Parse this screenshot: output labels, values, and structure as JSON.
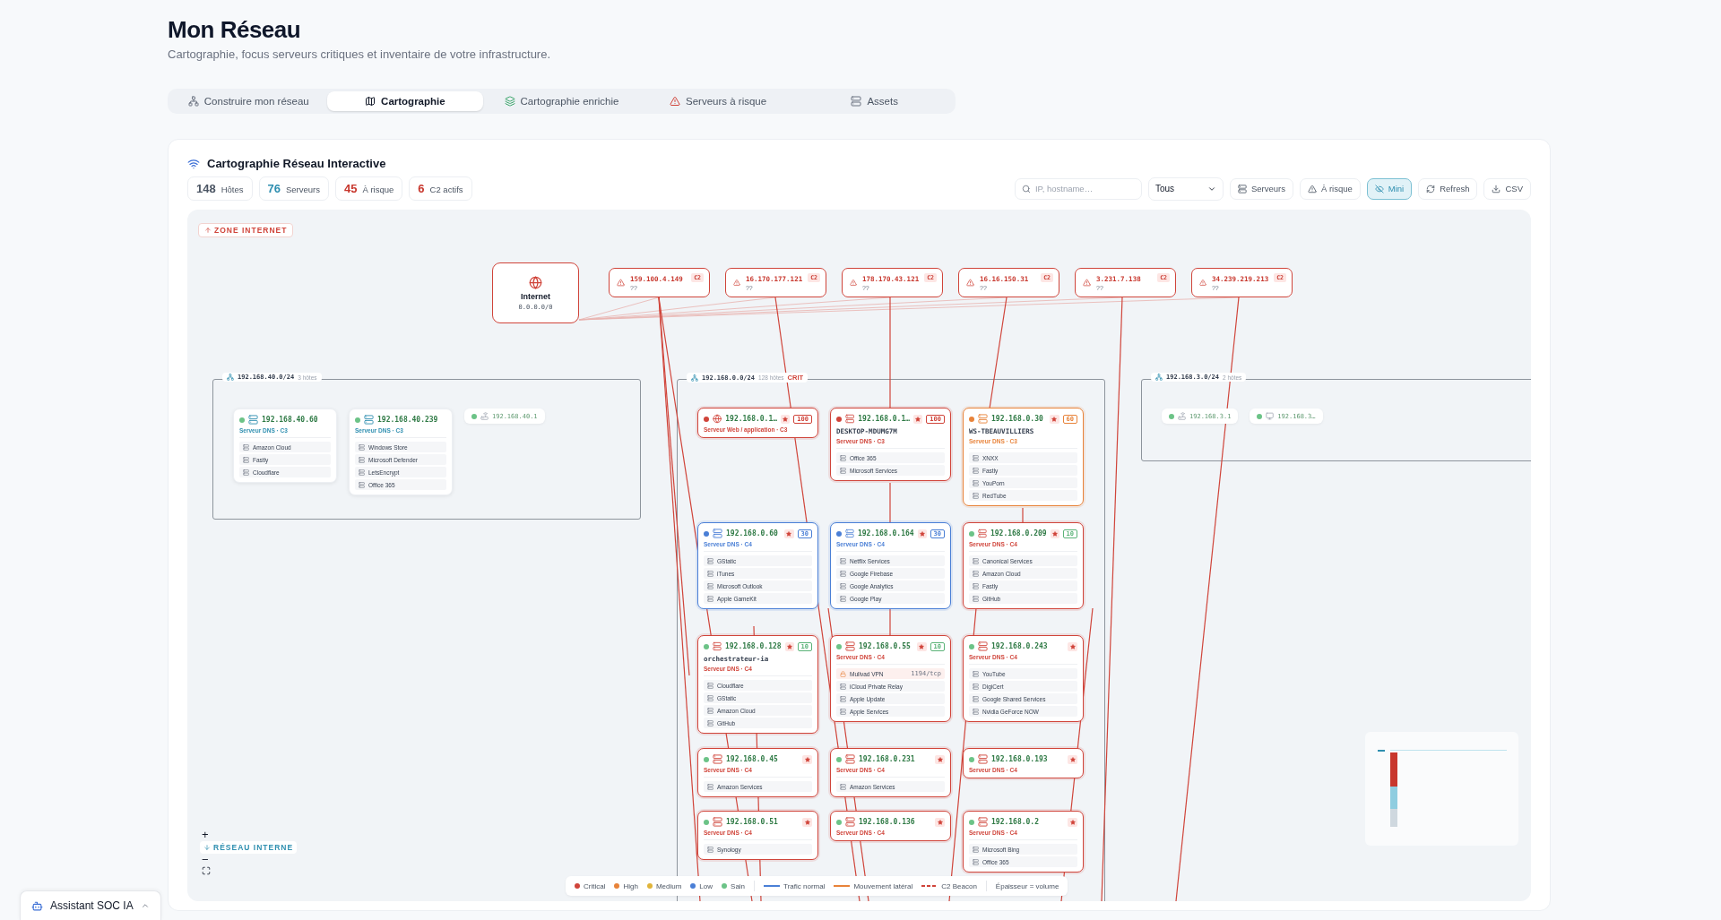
{
  "header": {
    "title": "Mon Réseau",
    "subtitle": "Cartographie, focus serveurs critiques et inventaire de votre infrastructure."
  },
  "tabs": [
    {
      "label": "Construire mon réseau",
      "selected": false
    },
    {
      "label": "Cartographie",
      "selected": true
    },
    {
      "label": "Cartographie enrichie",
      "selected": false
    },
    {
      "label": "Serveurs à risque",
      "selected": false
    },
    {
      "label": "Assets",
      "selected": false
    }
  ],
  "map": {
    "title": "Cartographie Réseau Interactive",
    "stats": [
      {
        "value": "148",
        "label": "Hôtes",
        "color": "#4b5563"
      },
      {
        "value": "76",
        "label": "Serveurs",
        "color": "#2f8fb0"
      },
      {
        "value": "45",
        "label": "À risque",
        "color": "#c8372d"
      },
      {
        "value": "6",
        "label": "C2 actifs",
        "color": "#c8372d"
      }
    ],
    "search": {
      "placeholder": "IP, hostname…"
    },
    "filter": "Tous",
    "buttons": [
      {
        "label": "Serveurs",
        "selected": false
      },
      {
        "label": "À risque",
        "selected": false
      },
      {
        "label": "Mini",
        "selected": true
      },
      {
        "label": "Refresh",
        "selected": false
      },
      {
        "label": "CSV",
        "selected": false
      }
    ],
    "zone_internet": "ZONE INTERNET",
    "zone_interne": "RÉSEAU INTERNE",
    "internet": {
      "label": "Internet",
      "address": "0.0.0.0/0"
    },
    "c2_nodes": [
      {
        "ip": "159.100.4.149",
        "host": "??",
        "tag": "C2"
      },
      {
        "ip": "16.170.177.121",
        "host": "??",
        "tag": "C2"
      },
      {
        "ip": "178.170.43.121",
        "host": "??",
        "tag": "C2"
      },
      {
        "ip": "16.16.150.31",
        "host": "??",
        "tag": "C2"
      },
      {
        "ip": "3.231.7.138",
        "host": "??",
        "tag": "C2"
      },
      {
        "ip": "34.239.219.213",
        "host": "??",
        "tag": "C2"
      }
    ],
    "subnets": [
      {
        "cidr": "192.168.40.0/24",
        "count": "3 hôtes",
        "hosts": [
          {
            "ip": "192.168.40.60",
            "kind": "server",
            "color": "#6cc387",
            "role": "Serveur DNS · C3",
            "flagged": false,
            "services": [
              {
                "name": "Amazon Cloud",
                "kind": "service"
              },
              {
                "name": "Fastly",
                "kind": "service"
              },
              {
                "name": "Cloudflare",
                "kind": "service"
              }
            ]
          },
          {
            "ip": "192.168.40.239",
            "kind": "server",
            "color": "#6cc387",
            "role": "Serveur DNS · C3",
            "flagged": false,
            "services": [
              {
                "name": "Windows Store",
                "kind": "service"
              },
              {
                "name": "Microsoft Defender",
                "kind": "service"
              },
              {
                "name": "LetsEncrypt",
                "kind": "service"
              },
              {
                "name": "Office 365",
                "kind": "service"
              }
            ]
          },
          {
            "ip": "192.168.40.1",
            "kind": "router",
            "color": "#6cc387"
          }
        ]
      },
      {
        "cidr": "192.168.0.0/24",
        "count": "128 hôtes",
        "tag": "CRIT",
        "hosts": [
          {
            "ip": "192.168.0.1…",
            "kind": "web",
            "color": "#d0443a",
            "role": "Serveur Web / application · C3",
            "border": {
              "color": "#d0443a"
            },
            "flagged": true,
            "score": {
              "value": "100",
              "color": "#d0443a"
            }
          },
          {
            "ip": "192.168.0.1…",
            "kind": "server",
            "color": "#d0443a",
            "hostname": "DESKTOP-MDUMG7M",
            "role": "Serveur DNS · C3",
            "border": {
              "color": "#d0443a"
            },
            "flagged": true,
            "score": {
              "value": "100",
              "color": "#d0443a"
            },
            "services": [
              {
                "name": "Office 365",
                "kind": "service"
              },
              {
                "name": "Microsoft Services",
                "kind": "service"
              }
            ]
          },
          {
            "ip": "192.168.0.30",
            "kind": "server",
            "color": "#e8833a",
            "hostname": "WS-TBEAUVILLIERS",
            "role": "Serveur DNS · C3",
            "border": {
              "color": "#e8833a"
            },
            "flagged": true,
            "score": {
              "value": "60",
              "color": "#e8833a"
            },
            "services": [
              {
                "name": "XNXX",
                "kind": "service"
              },
              {
                "name": "Fastly",
                "kind": "service"
              },
              {
                "name": "YouPorn",
                "kind": "service"
              },
              {
                "name": "RedTube",
                "kind": "service"
              }
            ]
          },
          {
            "ip": "192.168.0.60",
            "kind": "server",
            "color": "#4a7fd6",
            "role": "Serveur DNS · C4",
            "border": {
              "color": "#4a7fd6"
            },
            "flagged": true,
            "score": {
              "value": "30",
              "color": "#4a7fd6"
            },
            "services": [
              {
                "name": "GStatic",
                "kind": "service"
              },
              {
                "name": "iTunes",
                "kind": "service"
              },
              {
                "name": "Microsoft Outlook",
                "kind": "service"
              },
              {
                "name": "Apple GameKit",
                "kind": "service"
              }
            ]
          },
          {
            "ip": "192.168.0.164",
            "kind": "server",
            "color": "#4a7fd6",
            "role": "Serveur DNS · C4",
            "border": {
              "color": "#4a7fd6"
            },
            "flagged": true,
            "score": {
              "value": "30",
              "color": "#4a7fd6"
            },
            "services": [
              {
                "name": "Netflix Services",
                "kind": "service"
              },
              {
                "name": "Google Firebase",
                "kind": "service"
              },
              {
                "name": "Google Analytics",
                "kind": "service"
              },
              {
                "name": "Google Play",
                "kind": "service"
              }
            ]
          },
          {
            "ip": "192.168.0.209",
            "kind": "server",
            "color": "#6cc387",
            "role": "Serveur DNS · C4",
            "border": {
              "color": "#d0443a"
            },
            "flagged": true,
            "score": {
              "value": "10",
              "color": "#5bb378"
            },
            "services": [
              {
                "name": "Canonical Services",
                "kind": "service"
              },
              {
                "name": "Amazon Cloud",
                "kind": "service"
              },
              {
                "name": "Fastly",
                "kind": "service"
              },
              {
                "name": "GitHub",
                "kind": "service"
              }
            ]
          },
          {
            "ip": "192.168.0.128",
            "kind": "server",
            "color": "#6cc387",
            "hostname": "orchestrateur-ia",
            "role": "Serveur DNS · C4",
            "border": {
              "color": "#d0443a"
            },
            "flagged": true,
            "score": {
              "value": "10",
              "color": "#5bb378"
            },
            "services": [
              {
                "name": "Cloudflare",
                "kind": "service"
              },
              {
                "name": "GStatic",
                "kind": "service"
              },
              {
                "name": "Amazon Cloud",
                "kind": "service"
              },
              {
                "name": "GitHub",
                "kind": "service"
              }
            ]
          },
          {
            "ip": "192.168.0.55",
            "kind": "server",
            "color": "#6cc387",
            "role": "Serveur DNS · C4",
            "border": {
              "color": "#d0443a"
            },
            "flagged": true,
            "score": {
              "value": "10",
              "color": "#5bb378"
            },
            "services": [
              {
                "name": "Mullvad VPN",
                "kind": "vpn",
                "port": "1194/tcp"
              },
              {
                "name": "iCloud Private Relay",
                "kind": "service"
              },
              {
                "name": "Apple Update",
                "kind": "service"
              },
              {
                "name": "Apple Services",
                "kind": "service"
              }
            ]
          },
          {
            "ip": "192.168.0.243",
            "kind": "server",
            "color": "#6cc387",
            "role": "Serveur DNS · C4",
            "border": {
              "color": "#d0443a"
            },
            "flagged": true,
            "services": [
              {
                "name": "YouTube",
                "kind": "service"
              },
              {
                "name": "DigiCert",
                "kind": "service"
              },
              {
                "name": "Google Shared Services",
                "kind": "service"
              },
              {
                "name": "Nvidia GeForce NOW",
                "kind": "service"
              }
            ]
          },
          {
            "ip": "192.168.0.45",
            "kind": "server",
            "color": "#6cc387",
            "role": "Serveur DNS · C4",
            "border": {
              "color": "#d0443a"
            },
            "flagged": true,
            "services": [
              {
                "name": "Amazon Services",
                "kind": "service"
              }
            ]
          },
          {
            "ip": "192.168.0.231",
            "kind": "server",
            "color": "#6cc387",
            "role": "Serveur DNS · C4",
            "border": {
              "color": "#d0443a"
            },
            "flagged": true,
            "services": [
              {
                "name": "Amazon Services",
                "kind": "service"
              }
            ]
          },
          {
            "ip": "192.168.0.193",
            "kind": "server",
            "color": "#6cc387",
            "role": "Serveur DNS · C4",
            "border": {
              "color": "#d0443a"
            },
            "flagged": true
          },
          {
            "ip": "192.168.0.51",
            "kind": "server",
            "color": "#6cc387",
            "role": "Serveur DNS · C4",
            "border": {
              "color": "#d0443a"
            },
            "flagged": true,
            "services": [
              {
                "name": "Synology",
                "kind": "service"
              }
            ]
          },
          {
            "ip": "192.168.0.136",
            "kind": "server",
            "color": "#6cc387",
            "role": "Serveur DNS · C4",
            "border": {
              "color": "#d0443a"
            },
            "flagged": true
          },
          {
            "ip": "192.168.0.2",
            "kind": "server",
            "color": "#6cc387",
            "role": "Serveur DNS · C4",
            "border": {
              "color": "#d0443a"
            },
            "flagged": true,
            "services": [
              {
                "name": "Microsoft Bing",
                "kind": "service"
              },
              {
                "name": "Office 365",
                "kind": "service"
              }
            ]
          }
        ]
      },
      {
        "cidr": "192.168.3.0/24",
        "count": "2 hôtes",
        "hosts": [
          {
            "ip": "192.168.3.1",
            "kind": "router",
            "color": "#6cc387"
          },
          {
            "ip": "192.168.3…",
            "kind": "desktop",
            "color": "#6cc387"
          }
        ]
      }
    ],
    "legend": {
      "severities": [
        {
          "label": "Critical",
          "color": "#d0443a"
        },
        {
          "label": "High",
          "color": "#e8833a"
        },
        {
          "label": "Medium",
          "color": "#e0b43a"
        },
        {
          "label": "Low",
          "color": "#4a7fd6"
        },
        {
          "label": "Sain",
          "color": "#6cc387"
        }
      ],
      "flows": [
        {
          "label": "Trafic normal",
          "kind": "normal"
        },
        {
          "label": "Mouvement latéral",
          "kind": "lateral"
        },
        {
          "label": "C2 Beacon",
          "kind": "c2"
        }
      ],
      "note": "Épaisseur = volume"
    },
    "zoom_controls": [
      "+",
      "−"
    ]
  },
  "assistant": {
    "label": "Assistant SOC IA"
  }
}
